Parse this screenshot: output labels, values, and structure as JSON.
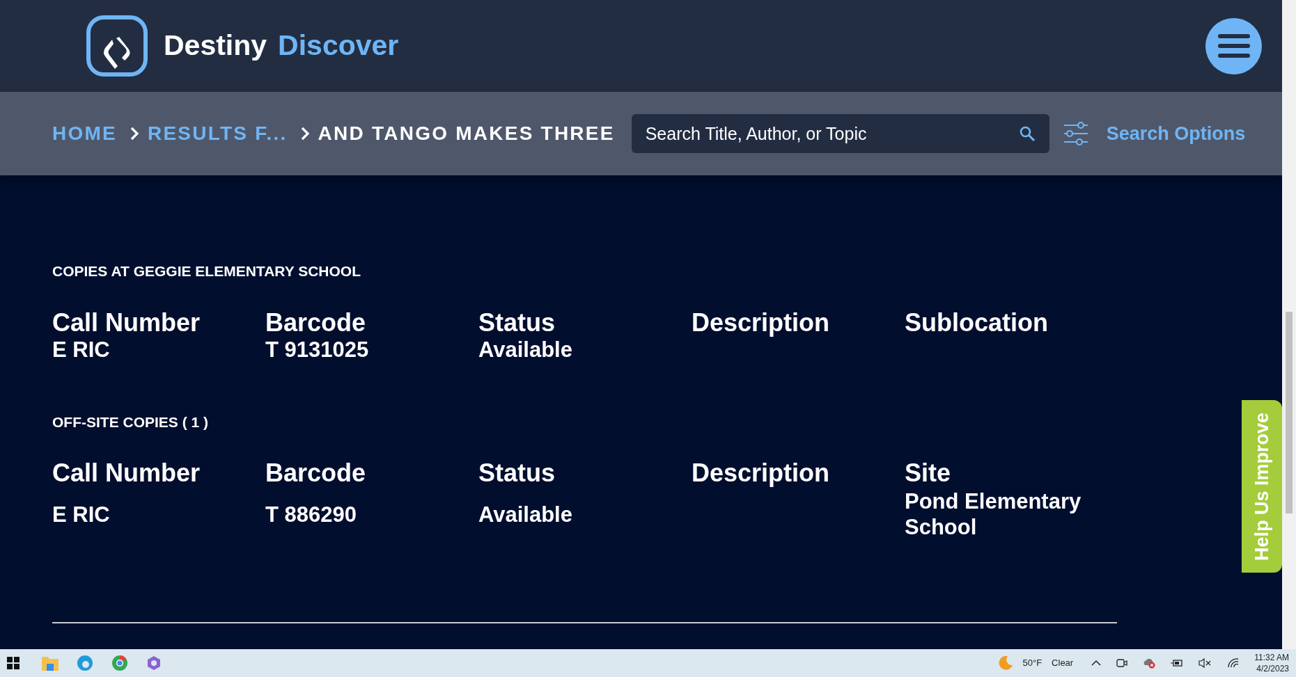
{
  "header": {
    "brand": [
      "Destiny",
      "Discover"
    ]
  },
  "breadcrumbs": [
    {
      "label": "HOME",
      "current": false
    },
    {
      "label": "RESULTS F...",
      "current": false
    },
    {
      "label": "AND TANGO MAKES THREE",
      "current": true
    }
  ],
  "search": {
    "placeholder": "Search Title, Author, or Topic"
  },
  "search_options": "Search Options",
  "sections": [
    {
      "heading": "COPIES AT GEGGIE ELEMENTARY SCHOOL",
      "columns": [
        "Call Number",
        "Barcode",
        "Status",
        "Description",
        "Sublocation"
      ],
      "rows": [
        [
          "E RIC",
          "T 9131025",
          "Available",
          "",
          ""
        ]
      ]
    },
    {
      "heading": "OFF-SITE COPIES ( 1 )",
      "columns": [
        "Call Number",
        "Barcode",
        "Status",
        "Description",
        "Site"
      ],
      "rows": [
        [
          "E RIC",
          "T 886290",
          "Available",
          "",
          "Pond Elementary School"
        ]
      ]
    }
  ],
  "help_tab": "Help Us Improve",
  "taskbar": {
    "temperature": "50°F",
    "weather": "Clear",
    "time": "11:32 AM",
    "date": "4/2/2023"
  }
}
